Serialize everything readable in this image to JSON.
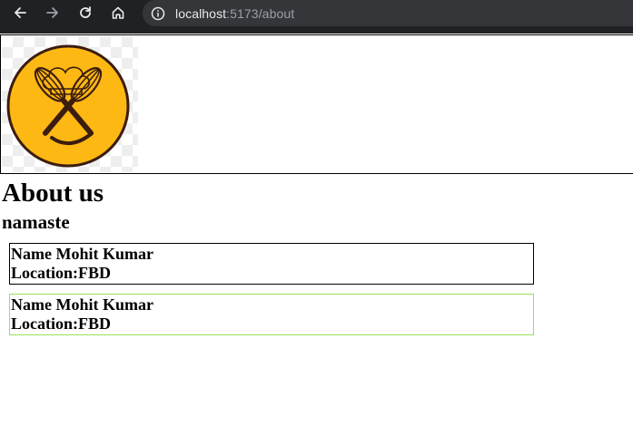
{
  "browser": {
    "url_host": "localhost",
    "url_path": ":5173/about"
  },
  "page": {
    "title": "About us",
    "subtitle": "namaste",
    "cards": [
      {
        "name": "Name Mohit Kumar",
        "location": "Location:FBD"
      },
      {
        "name": "Name Mohit Kumar",
        "location": "Location:FBD"
      }
    ]
  },
  "colors": {
    "logo_fill": "#FDB813",
    "logo_stroke": "#3b1d0f",
    "card2_border": "#9be15d"
  },
  "icons": [
    "back-arrow-icon",
    "forward-arrow-icon",
    "reload-icon",
    "home-icon",
    "info-icon"
  ]
}
